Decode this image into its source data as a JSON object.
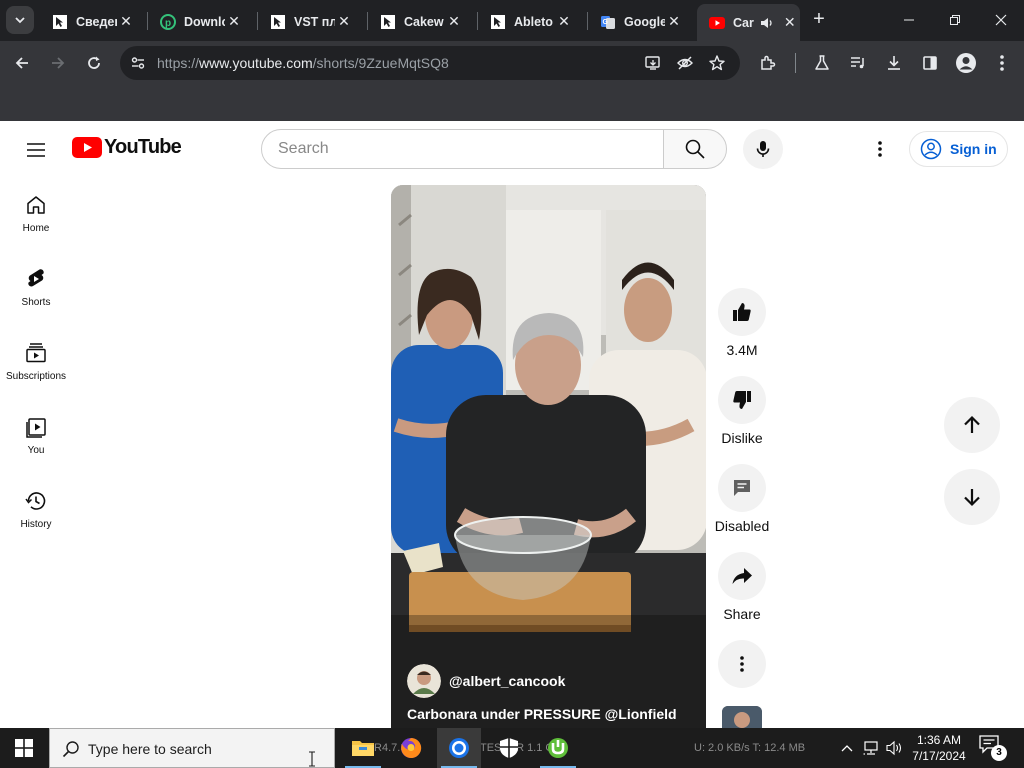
{
  "browser": {
    "tabs": [
      {
        "label": "Сведен",
        "icon": "cursor-page-icon",
        "active": false
      },
      {
        "label": "Downlo",
        "icon": "green-p-logo-icon",
        "active": false
      },
      {
        "label": "VST пл",
        "icon": "cursor-page-icon",
        "active": false
      },
      {
        "label": "Cakew",
        "icon": "cursor-page-icon",
        "active": false
      },
      {
        "label": "Ableto",
        "icon": "cursor-page-icon",
        "active": false
      },
      {
        "label": "Google",
        "icon": "google-translate-icon",
        "active": false
      },
      {
        "label": "Car",
        "icon": "youtube-icon",
        "active": true
      }
    ],
    "url_prefix": "https://",
    "url_host": "www.youtube.com",
    "url_path": "/shorts/9ZzueMqtSQ8"
  },
  "youtube": {
    "logo_text": "YouTube",
    "search_placeholder": "Search",
    "sign_in_label": "Sign in",
    "guide": [
      {
        "label": "Home",
        "icon": "home-icon"
      },
      {
        "label": "Shorts",
        "icon": "shorts-icon"
      },
      {
        "label": "Subscriptions",
        "icon": "subscriptions-icon"
      },
      {
        "label": "You",
        "icon": "you-icon"
      },
      {
        "label": "History",
        "icon": "history-icon"
      }
    ],
    "short": {
      "channel": "@albert_cancook",
      "title_text": "Carbonara under PRESSURE ",
      "title_mention": "@Lionfield"
    },
    "actions": {
      "like_count": "3.4M",
      "dislike_label": "Dislike",
      "comments_label": "Disabled",
      "share_label": "Share"
    }
  },
  "taskbar": {
    "search_placeholder": "Type here to search",
    "ghost_text_left": "VTR4.7.3",
    "ghost_text_mid": "TESSER 1.1 GB",
    "ghost_text_right": "U: 2.0 KB/s  T: 12.4 MB",
    "time": "1:36 AM",
    "date": "7/17/2024",
    "notification_count": "3"
  },
  "colors": {
    "brand_red": "#ff0000",
    "link_blue": "#065fd4",
    "chrome_dark": "#202124",
    "chrome_toolbar": "#35363a"
  }
}
